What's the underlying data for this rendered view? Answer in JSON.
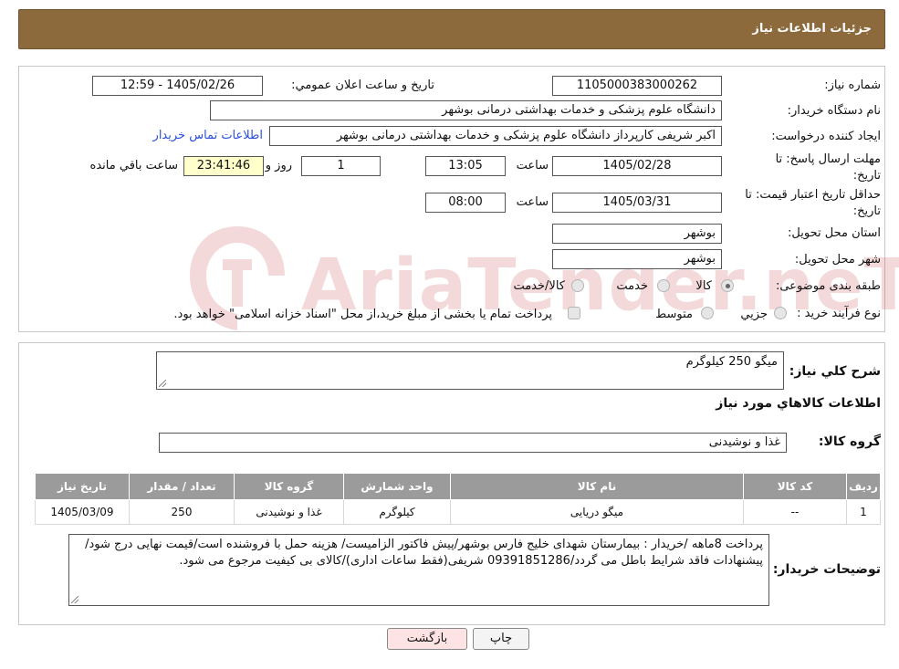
{
  "header": {
    "title": "جزئیات اطلاعات نیاز"
  },
  "watermark": {
    "text": "AriaTender.neT"
  },
  "fields": {
    "need_number_label": "شماره نیاز:",
    "need_number": "1105000383000262",
    "announce_label": "تاریخ و ساعت اعلان عمومي:",
    "announce_value": "1405/02/26 - 12:59",
    "buyer_org_label": "نام دستگاه خريدار:",
    "buyer_org": "دانشگاه علوم پزشکی و خدمات بهداشتی درمانی بوشهر",
    "creator_label": "ايجاد کننده درخواست:",
    "creator": "اکبر شریفی کارپرداز دانشگاه علوم پزشکی و خدمات بهداشتی درمانی بوشهر",
    "contact_link": "اطلاعات تماس خريدار",
    "deadline_label": "مهلت ارسال پاسخ: تا تاریخ:",
    "deadline_date": "1405/02/28",
    "time_label": "ساعت",
    "deadline_time": "13:05",
    "days_value": "1",
    "days_label": "روز و",
    "remaining_time": "23:41:46",
    "remaining_label": "ساعت باقي مانده",
    "validity_label": "حداقل تاريخ اعتبار قيمت: تا تاريخ:",
    "validity_date": "1405/03/31",
    "validity_time": "08:00",
    "province_label": "استان محل تحويل:",
    "province": "بوشهر",
    "city_label": "شهر محل تحويل:",
    "city": "بوشهر",
    "category_label": "طبقه بندی موضوعی:",
    "category_options": [
      "کالا",
      "خدمت",
      "کالا/خدمت"
    ],
    "process_label": "نوع فرآيند خريد :",
    "process_options": [
      "جزيي",
      "متوسط"
    ],
    "process_note": "پرداخت تمام يا بخشی از مبلغ خريد،از محل \"اسناد خزانه اسلامی\" خواهد بود."
  },
  "summary": {
    "desc_label": "شرح کلي نياز:",
    "desc_value": "میگو 250 کیلوگرم",
    "goods_info_title": "اطلاعات کالاهاي مورد نياز",
    "group_label": "گروه کالا:",
    "group_value": "غذا و نوشیدنی"
  },
  "table": {
    "headers": [
      "رديف",
      "کد کالا",
      "نام کالا",
      "واحد شمارش",
      "گروه کالا",
      "تعداد / مقدار",
      "تاريخ نياز"
    ],
    "rows": [
      [
        "1",
        "--",
        "میگو دریایی",
        "کیلوگرم",
        "غذا و نوشیدنی",
        "250",
        "1405/03/09"
      ]
    ]
  },
  "notes": {
    "label": "توضيحات خريدار:",
    "text": "پرداخت 8ماهه /خریدار : بیمارستان شهدای خلیج فارس بوشهر/پیش فاکتور الزامیست/ هزینه حمل با فروشنده است/قیمت نهایی درج شود/پیشنهادات فاقد شرایط باطل می گردد/09391851286 شریفی(فقط ساعات اداری)/کالای بی کیفیت مرجوع می شود."
  },
  "buttons": {
    "print": "چاپ",
    "back": "بازگشت"
  },
  "colors": {
    "header_bg": "#8c6a3c",
    "link": "#2b4fd8",
    "table_header": "#9b9b9b",
    "back_button": "#fde3e3"
  }
}
